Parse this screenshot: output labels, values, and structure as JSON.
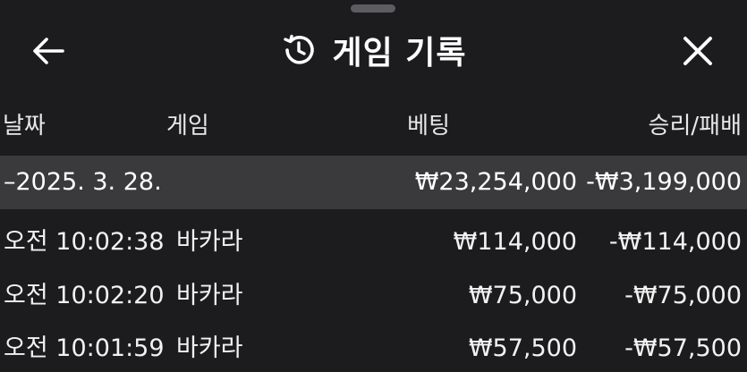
{
  "header": {
    "title": "게임 기록",
    "back_icon": "arrow-left-icon",
    "history_icon": "history-icon",
    "close_icon": "close-icon"
  },
  "columns": {
    "date": "날짜",
    "game": "게임",
    "bet": "베팅",
    "result": "승리/패배"
  },
  "date_group": {
    "label": "–2025. 3. 28.",
    "bet_total": "₩23,254,000",
    "result_total": "-₩3,199,000"
  },
  "rows": [
    {
      "time": "오전 10:02:38",
      "game": "바카라",
      "bet": "₩114,000",
      "result": "-₩114,000"
    },
    {
      "time": "오전 10:02:20",
      "game": "바카라",
      "bet": "₩75,000",
      "result": "-₩75,000"
    },
    {
      "time": "오전 10:01:59",
      "game": "바카라",
      "bet": "₩57,500",
      "result": "-₩57,500"
    }
  ],
  "colors": {
    "background": "#1c1c1e",
    "date_row_background": "#3a3a3c",
    "text": "#f2f2f2"
  }
}
